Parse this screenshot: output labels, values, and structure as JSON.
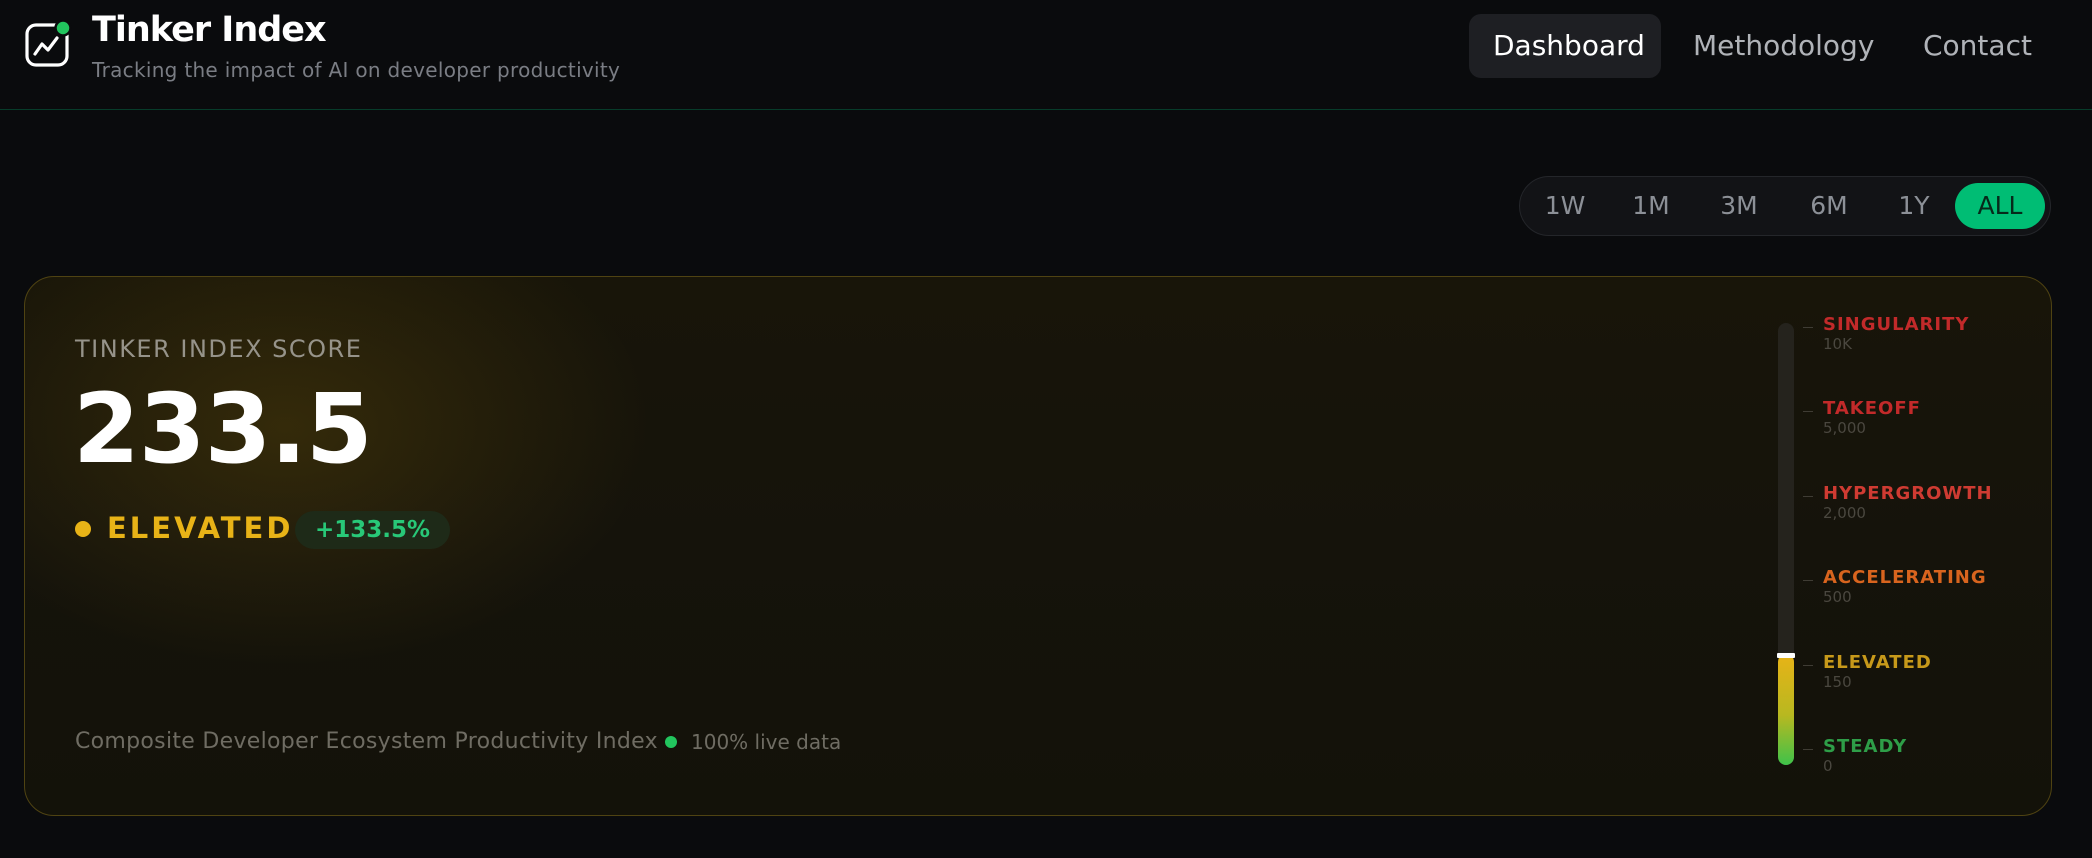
{
  "brand": {
    "title": "Tinker Index",
    "subtitle": "Tracking the impact of AI on developer productivity",
    "logo_icon": "chart-line-icon",
    "logo_dot_color": "#22c55e"
  },
  "nav": {
    "items": [
      {
        "label": "Dashboard",
        "active": true
      },
      {
        "label": "Methodology",
        "active": false
      },
      {
        "label": "Contact",
        "active": false
      }
    ]
  },
  "time_range": {
    "options": [
      "1W",
      "1M",
      "3M",
      "6M",
      "1Y",
      "ALL"
    ],
    "selected": "ALL",
    "accent_color": "#00bd74"
  },
  "score_card": {
    "label": "TINKER INDEX SCORE",
    "value": "233.5",
    "status": "ELEVATED",
    "status_color": "#e8b317",
    "change": "+133.5%",
    "change_color": "#28c878",
    "description": "Composite Developer Ecosystem Productivity Index",
    "live_data": "100% live data"
  },
  "gauge": {
    "current_level_fraction": 0.25,
    "levels": [
      {
        "name": "SINGULARITY",
        "value": "10K",
        "color": "#c22a2a"
      },
      {
        "name": "TAKEOFF",
        "value": "5,000",
        "color": "#c22a2a"
      },
      {
        "name": "HYPERGROWTH",
        "value": "2,000",
        "color": "#cf3b32"
      },
      {
        "name": "ACCELERATING",
        "value": "500",
        "color": "#d8641e"
      },
      {
        "name": "ELEVATED",
        "value": "150",
        "color": "#c7991a"
      },
      {
        "name": "STEADY",
        "value": "0",
        "color": "#2e9e48"
      }
    ]
  }
}
